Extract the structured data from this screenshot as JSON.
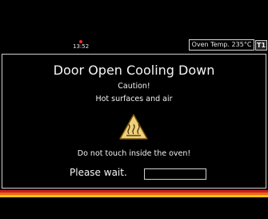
{
  "status_bar": {
    "time": "13:52",
    "oven_temp": "Oven Temp. 235°C",
    "tray_badge": "T1",
    "indicator_color": "#e53030"
  },
  "dialog": {
    "title": "Door Open Cooling Down",
    "caution": "Caution!",
    "hot_surfaces": "Hot surfaces and air",
    "warning_icon": "hot-surface-warning-icon",
    "do_not_touch": "Do not touch inside the oven!",
    "please_wait": "Please wait.",
    "progress": 0
  },
  "colors": {
    "warning_fill": "#f0d07a",
    "warning_stroke": "#7a5a10",
    "stripe_red": "#d21d1d",
    "stripe_orange": "#e66a12",
    "stripe_yellow": "#f1c21a"
  }
}
